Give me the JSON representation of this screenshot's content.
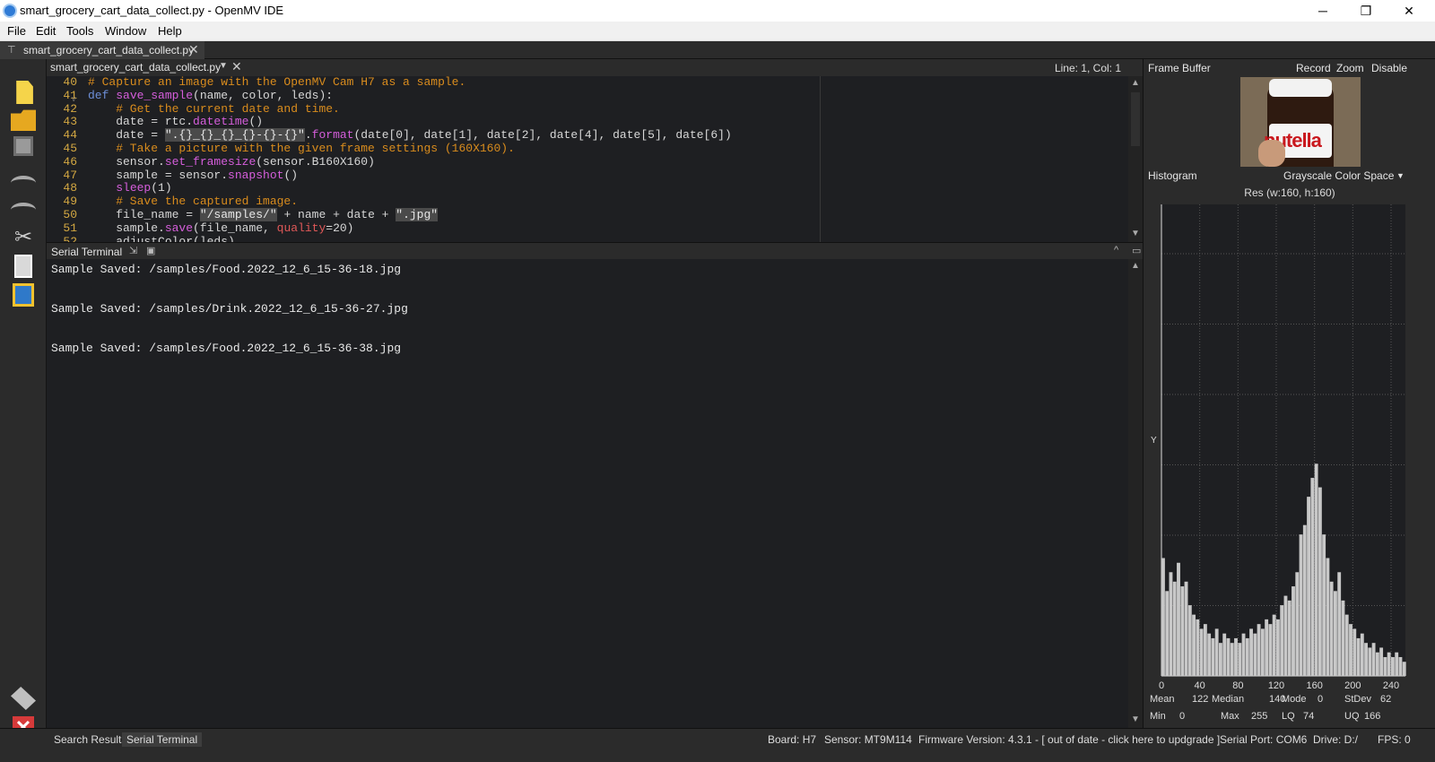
{
  "window": {
    "title": "smart_grocery_cart_data_collect.py - OpenMV IDE",
    "controls": {
      "minimize": "─",
      "restore": "❐",
      "close": "✕"
    }
  },
  "menu": [
    "File",
    "Edit",
    "Tools",
    "Window",
    "Help"
  ],
  "file_tab": {
    "label": "smart_grocery_cart_data_collect.py",
    "close": "✕"
  },
  "editor": {
    "doc_selector": "smart_grocery_cart_data_collect.py",
    "doc_dropdown": "▼",
    "doc_close": "✕",
    "cursor_position": "Line: 1, Col: 1",
    "line_numbers": [
      "40",
      "41",
      "42",
      "43",
      "44",
      "45",
      "46",
      "47",
      "48",
      "49",
      "50",
      "51",
      "52"
    ],
    "fold_marker": "v",
    "lines": [
      [
        {
          "t": "# Capture an image with the OpenMV Cam H7 as a sample.",
          "c": "cm"
        }
      ],
      [
        {
          "t": "def ",
          "c": "kw"
        },
        {
          "t": "save_sample",
          "c": "fn"
        },
        {
          "t": "(name, color, leds):",
          "c": ""
        }
      ],
      [
        {
          "t": "    # Get the current date and time.",
          "c": "cm"
        }
      ],
      [
        {
          "t": "    date = rtc.",
          "c": ""
        },
        {
          "t": "datetime",
          "c": "fn"
        },
        {
          "t": "()",
          "c": ""
        }
      ],
      [
        {
          "t": "    date = ",
          "c": ""
        },
        {
          "t": "\".{}_{}_{}_{}-{}-{}\"",
          "c": "st"
        },
        {
          "t": ".",
          "c": ""
        },
        {
          "t": "format",
          "c": "fn"
        },
        {
          "t": "(date[0], date[1], date[2], date[4], date[5], date[6])",
          "c": ""
        }
      ],
      [
        {
          "t": "    # Take a picture with the given frame settings (160X160).",
          "c": "cm"
        }
      ],
      [
        {
          "t": "    sensor.",
          "c": ""
        },
        {
          "t": "set_framesize",
          "c": "fn"
        },
        {
          "t": "(sensor.B160X160)",
          "c": ""
        }
      ],
      [
        {
          "t": "    sample = sensor.",
          "c": ""
        },
        {
          "t": "snapshot",
          "c": "fn"
        },
        {
          "t": "()",
          "c": ""
        }
      ],
      [
        {
          "t": "    ",
          "c": ""
        },
        {
          "t": "sleep",
          "c": "fn"
        },
        {
          "t": "(1)",
          "c": ""
        }
      ],
      [
        {
          "t": "    # Save the captured image.",
          "c": "cm"
        }
      ],
      [
        {
          "t": "    file_name = ",
          "c": ""
        },
        {
          "t": "\"/samples/\"",
          "c": "st"
        },
        {
          "t": " + name + date + ",
          "c": ""
        },
        {
          "t": "\".jpg\"",
          "c": "st"
        }
      ],
      [
        {
          "t": "    sample.",
          "c": ""
        },
        {
          "t": "save",
          "c": "fn"
        },
        {
          "t": "(file_name, ",
          "c": ""
        },
        {
          "t": "quality",
          "c": "num"
        },
        {
          "t": "=20)",
          "c": ""
        }
      ],
      [
        {
          "t": "    adjustColor(leds)",
          "c": ""
        }
      ]
    ]
  },
  "serial_terminal": {
    "title": "Serial Terminal",
    "lines": [
      "Sample Saved: /samples/Food.2022_12_6_15-36-18.jpg",
      "Sample Saved: /samples/Drink.2022_12_6_15-36-27.jpg",
      "Sample Saved: /samples/Food.2022_12_6_15-36-38.jpg"
    ]
  },
  "frame_buffer": {
    "title": "Frame Buffer",
    "record": "Record",
    "zoom": "Zoom",
    "disable": "Disable",
    "image_logo": "nutella"
  },
  "histogram": {
    "title": "Histogram",
    "color_space": "Grayscale Color Space",
    "dropdown": "▼",
    "resolution": "Res (w:160, h:160)",
    "y_label": "Y",
    "x_ticks": [
      "0",
      "40",
      "80",
      "120",
      "160",
      "200",
      "240"
    ],
    "stats": {
      "mean_label": "Mean",
      "mean": "122",
      "median_label": "Median",
      "median": "140",
      "mode_label": "Mode",
      "mode": "0",
      "stdev_label": "StDev",
      "stdev": "62",
      "min_label": "Min",
      "min": "0",
      "max_label": "Max",
      "max": "255",
      "lq_label": "LQ",
      "lq": "74",
      "uq_label": "UQ",
      "uq": "166"
    }
  },
  "chart_data": {
    "type": "area",
    "title": "",
    "xlabel": "",
    "ylabel": "Y",
    "xlim": [
      0,
      255
    ],
    "ylim": [
      0,
      1
    ],
    "grid": true,
    "x": [
      0,
      4,
      8,
      12,
      16,
      20,
      24,
      28,
      32,
      36,
      40,
      44,
      48,
      52,
      56,
      60,
      64,
      68,
      72,
      76,
      80,
      84,
      88,
      92,
      96,
      100,
      104,
      108,
      112,
      116,
      120,
      124,
      128,
      132,
      136,
      140,
      144,
      148,
      152,
      156,
      160,
      164,
      168,
      172,
      176,
      180,
      184,
      188,
      192,
      196,
      200,
      204,
      208,
      212,
      216,
      220,
      224,
      228,
      232,
      236,
      240,
      244,
      248,
      252
    ],
    "values": [
      0.25,
      0.18,
      0.22,
      0.2,
      0.24,
      0.19,
      0.2,
      0.15,
      0.13,
      0.12,
      0.1,
      0.11,
      0.09,
      0.08,
      0.1,
      0.07,
      0.09,
      0.08,
      0.07,
      0.08,
      0.07,
      0.09,
      0.08,
      0.1,
      0.09,
      0.11,
      0.1,
      0.12,
      0.11,
      0.13,
      0.12,
      0.15,
      0.17,
      0.16,
      0.19,
      0.22,
      0.3,
      0.32,
      0.38,
      0.42,
      0.45,
      0.4,
      0.3,
      0.25,
      0.2,
      0.18,
      0.22,
      0.16,
      0.13,
      0.11,
      0.1,
      0.08,
      0.09,
      0.07,
      0.06,
      0.07,
      0.05,
      0.06,
      0.04,
      0.05,
      0.04,
      0.05,
      0.04,
      0.03
    ]
  },
  "status_bar": {
    "search_results": "Search Results",
    "serial_terminal": "Serial Terminal",
    "board": "Board: H7",
    "sensor": "Sensor: MT9M114",
    "firmware": "Firmware Version: 4.3.1 - [ out of date - click here to updgrade ]",
    "serial_port": "Serial Port: COM6",
    "drive": "Drive: D:/",
    "fps": "FPS: 0"
  },
  "toolbar_icons": [
    "new-file-icon",
    "open-folder-icon",
    "save-icon",
    "undo-icon",
    "redo-icon",
    "cut-icon",
    "copy-icon",
    "paste-icon",
    "connect-icon",
    "stop-icon"
  ]
}
